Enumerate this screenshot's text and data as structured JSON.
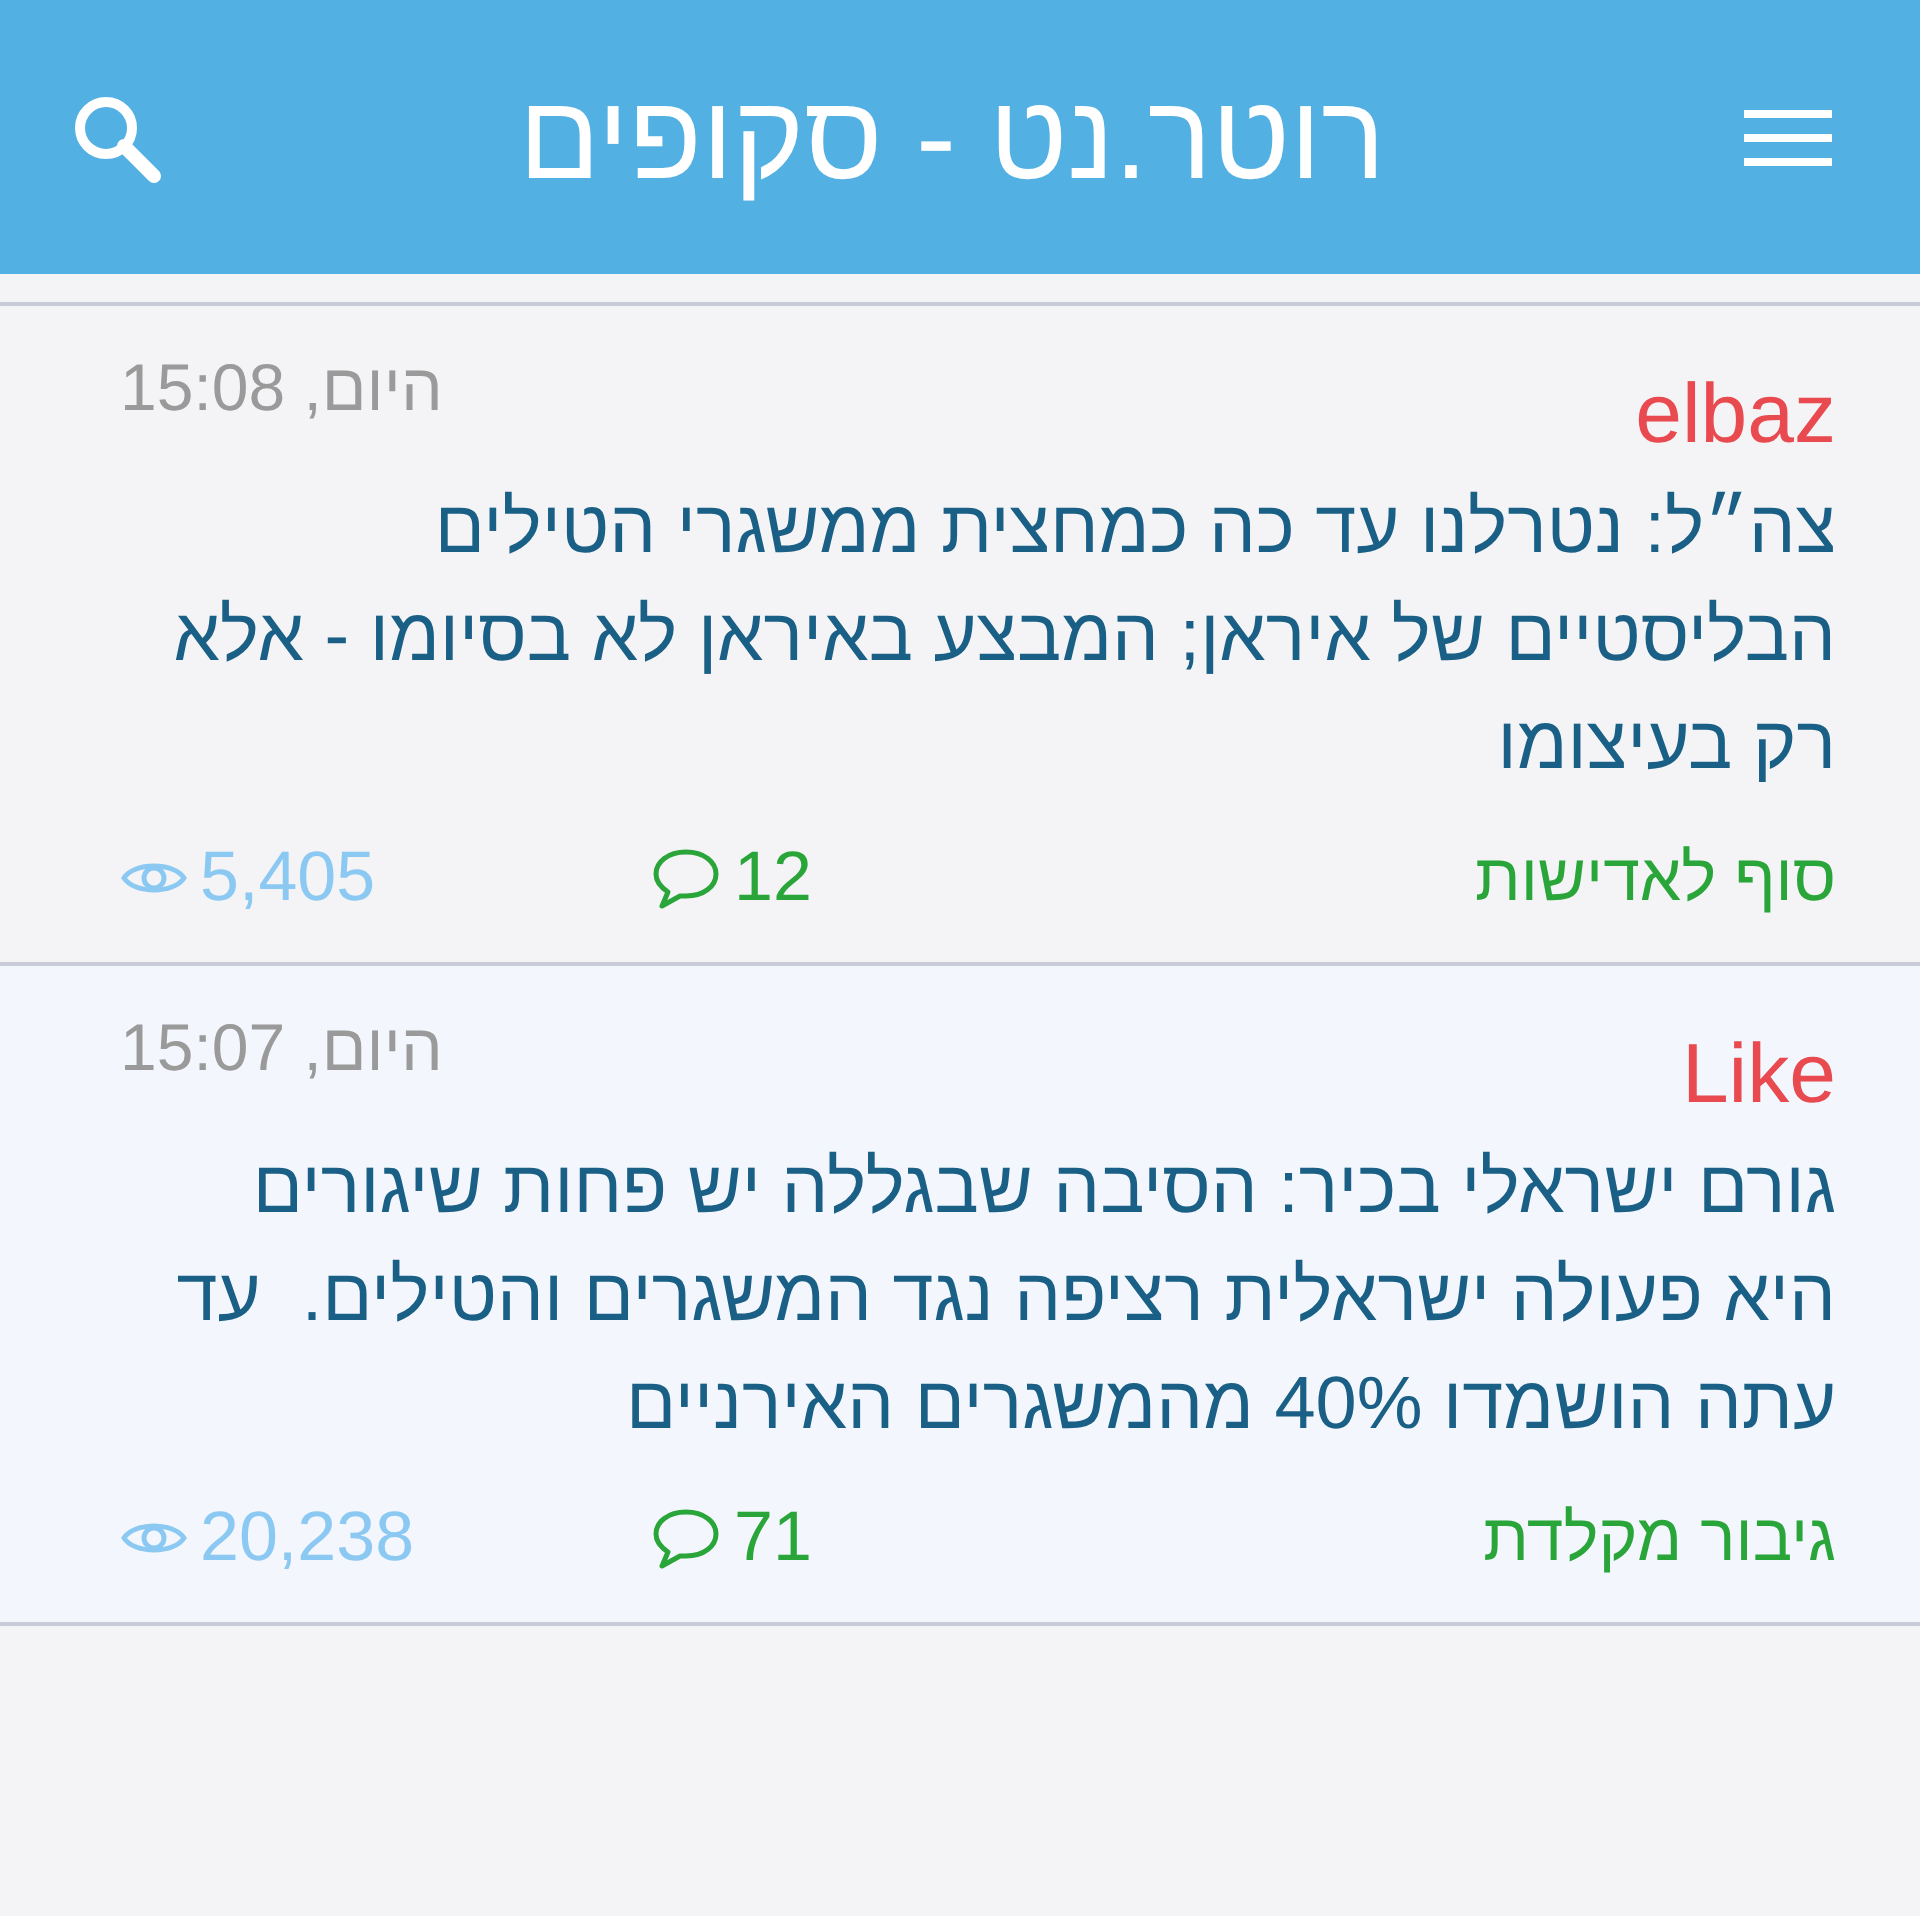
{
  "header": {
    "title": "רוטר.נט - סקופים"
  },
  "posts": [
    {
      "author": "elbaz",
      "time": "היום, 15:08",
      "body": "צה״ל: נטרלנו עד כה כמחצית ממשגרי הטילים הבליסטיים של איראן; המבצע באיראן לא בסיומו - אלא רק בעיצומו",
      "category": "סוף לאדישות",
      "comments": "12",
      "views": "5,405"
    },
    {
      "author": "Like",
      "time": "היום, 15:07",
      "body": "גורם ישראלי בכיר: הסיבה שבגללה יש פחות שיגורים היא פעולה ישראלית רציפה נגד המשגרים והטילים.  עד עתה הושמדו 40% מהמשגרים האירניים",
      "category": "גיבור מקלדת",
      "comments": "71",
      "views": "20,238"
    }
  ]
}
